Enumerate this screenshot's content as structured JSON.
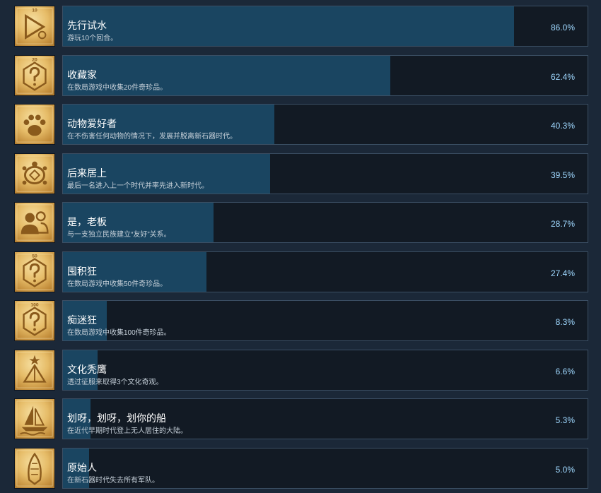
{
  "achievements": [
    {
      "title": "先行试水",
      "desc": "游玩10个回合。",
      "percent_label": "86.0%",
      "percent": 86.0,
      "icon": "play-turns-icon",
      "badge": "10"
    },
    {
      "title": "收藏家",
      "desc": "在数局游戏中收集20件奇珍品。",
      "percent_label": "62.4%",
      "percent": 62.4,
      "icon": "question-hexagon-icon",
      "badge": "20"
    },
    {
      "title": "动物爱好者",
      "desc": "在不伤害任何动物的情况下，发展并脱离新石器时代。",
      "percent_label": "40.3%",
      "percent": 40.3,
      "icon": "paw-print-icon",
      "badge": ""
    },
    {
      "title": "后来居上",
      "desc": "最后一名进入上一个时代并率先进入新时代。",
      "percent_label": "39.5%",
      "percent": 39.5,
      "icon": "turtle-icon",
      "badge": ""
    },
    {
      "title": "是，老板",
      "desc": "与一支独立民族建立“友好”关系。",
      "percent_label": "28.7%",
      "percent": 28.7,
      "icon": "two-people-icon",
      "badge": ""
    },
    {
      "title": "囤积狂",
      "desc": "在数局游戏中收集50件奇珍品。",
      "percent_label": "27.4%",
      "percent": 27.4,
      "icon": "question-hexagon-icon",
      "badge": "50"
    },
    {
      "title": "痴迷狂",
      "desc": "在数局游戏中收集100件奇珍品。",
      "percent_label": "8.3%",
      "percent": 8.3,
      "icon": "question-hexagon-icon",
      "badge": "100"
    },
    {
      "title": "文化秃鹰",
      "desc": "透过征服来取得3个文化奇观。",
      "percent_label": "6.6%",
      "percent": 6.6,
      "icon": "pyramid-star-icon",
      "badge": ""
    },
    {
      "title": "划呀，划呀，划你的船",
      "desc": "在近代早期时代登上无人居住的大陆。",
      "percent_label": "5.3%",
      "percent": 5.3,
      "icon": "sailboat-icon",
      "badge": ""
    },
    {
      "title": "原始人",
      "desc": "在新石器时代失去所有军队。",
      "percent_label": "5.0%",
      "percent": 5.0,
      "icon": "stone-arrowhead-icon",
      "badge": ""
    }
  ],
  "colors": {
    "background": "#1b2838",
    "bar_background": "#121a24",
    "bar_fill": "#1a4561",
    "bar_border": "#3b4f64",
    "icon_gold": "#e6bc68",
    "title_text": "#ffffff",
    "desc_text": "#c5cfd8",
    "percent_text": "#9fd8ff"
  }
}
